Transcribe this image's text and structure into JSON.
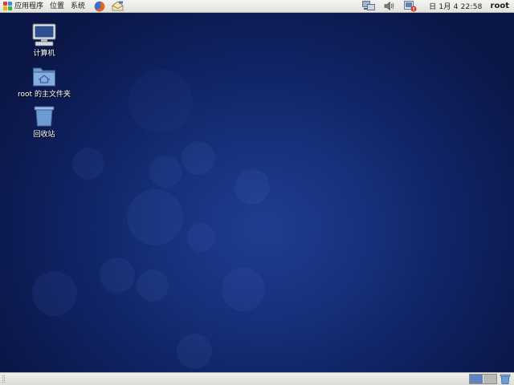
{
  "top_panel": {
    "menus": [
      {
        "label": "应用程序",
        "icon": "gnome-foot-icon"
      },
      {
        "label": "位置"
      },
      {
        "label": "系统"
      }
    ],
    "launchers": [
      {
        "name": "firefox-launcher",
        "icon": "firefox-icon"
      },
      {
        "name": "mail-launcher",
        "icon": "mail-icon"
      }
    ],
    "tray": [
      "network-icon",
      "volume-icon",
      "update-notifier-icon"
    ],
    "clock": "日 1月  4 22:58",
    "user": "root"
  },
  "desktop": {
    "icons": [
      {
        "label": "计算机",
        "icon": "computer-icon"
      },
      {
        "label": "root 的主文件夹",
        "icon": "home-folder-icon"
      },
      {
        "label": "回收站",
        "icon": "trash-icon"
      }
    ]
  },
  "bottom_panel": {
    "workspaces": [
      {
        "active": true
      },
      {
        "active": false
      }
    ],
    "trash_applet": "trash-icon"
  },
  "colors": {
    "panel": "#e6e6e3",
    "desktop_center": "#1f3d8f",
    "desktop_edge": "#0a1645",
    "workspace_active": "#5d84c0"
  }
}
